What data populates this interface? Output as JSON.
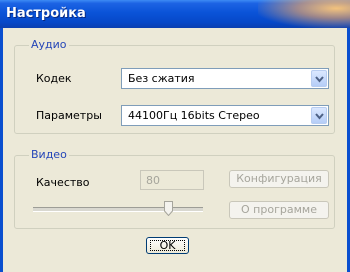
{
  "window": {
    "title": "Настройка"
  },
  "audio": {
    "group_title": "Аудио",
    "codec_label": "Кодек",
    "codec_value": "Без сжатия",
    "params_label": "Параметры",
    "params_value": "44100Гц  16bits Стерео"
  },
  "video": {
    "group_title": "Видео",
    "quality_label": "Качество",
    "quality_value": "80",
    "slider_value_fraction": 0.8,
    "configure_label": "Конфигурация",
    "about_label": "О программе"
  },
  "ok_label": "OK",
  "colors": {
    "titlebar": "#0a53d8",
    "window_bg": "#ece9d8",
    "group_title": "#2546b8",
    "disabled_text": "#a6a59c"
  }
}
